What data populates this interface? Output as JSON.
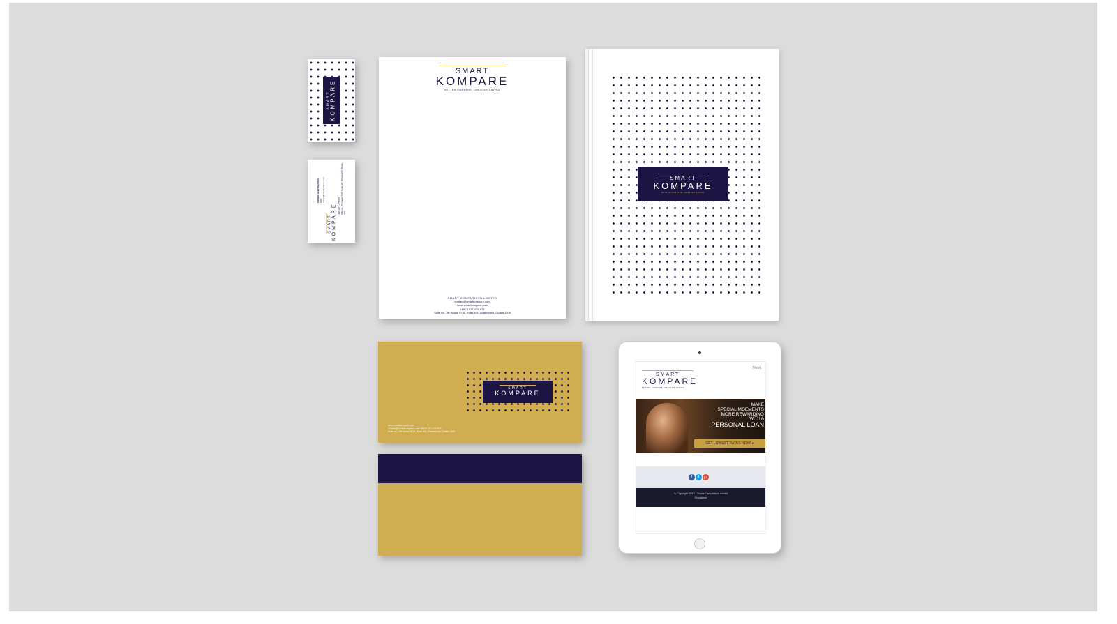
{
  "brand": {
    "smart": "SMART",
    "kompare": "KOMPARE",
    "tagline": "BETTER KOMPARE, GREATER SAVING"
  },
  "letterhead": {
    "company": "SMART COMPARISON LIMITED",
    "email": "contact@smartkompare.com",
    "web": "www.smartkompare.com",
    "phone": "+880 1977-475-875",
    "address": "Suite no. 7th House 57/A, Road 4/A, Dhanmondi, Dhaka 1209"
  },
  "business_card": {
    "name": "RAINIER E HASIN (MSR)",
    "title": "CEO",
    "email": "rainier@smartkompare.com",
    "phone": "+880 1977-475-875",
    "address": "Suite no. 7th House 57/A, Road 4/A, Dhanmondi, Dhaka 1209"
  },
  "envelope": {
    "web": "www.smartkompare.com",
    "contact": "contact@smartkompare.com  +880 1977-475-875",
    "address": "Suite no. 7th House 57/A, Road 4/A, Dhanmondi, Dhaka 1209"
  },
  "tablet": {
    "nav": "Menu",
    "hero_line1": "MAKE",
    "hero_line2": "SPECIAL MOEMENTS",
    "hero_line3": "MORE REWARDING",
    "hero_line4": "WITH A",
    "hero_line5": "PERSONAL LOAN",
    "cta": "GET LOWEST RATES NOW! ▸",
    "social": [
      "f",
      "t",
      "g+"
    ],
    "copyright": "© Copyright 2015 - Smart Comparison limited",
    "disclaimer": "Disclaimer"
  },
  "colors": {
    "navy": "#1d1645",
    "gold": "#d1ad52",
    "background": "#dcdcdc",
    "facebook": "#3b5998",
    "twitter": "#1da1f2",
    "googleplus": "#dd4b39"
  }
}
